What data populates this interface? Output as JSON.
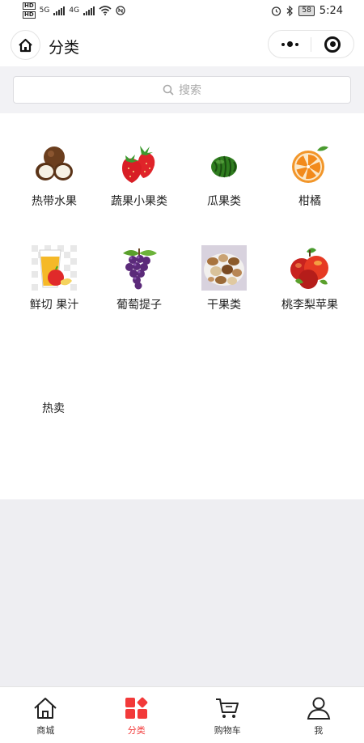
{
  "status_bar": {
    "network_labels": [
      "HD",
      "HD"
    ],
    "net1": "5G",
    "net2": "4G",
    "battery": "58",
    "time": "5:24"
  },
  "nav": {
    "title": "分类"
  },
  "search": {
    "placeholder": "搜索"
  },
  "categories": [
    {
      "label": "热带水果",
      "icon": "coconut-icon"
    },
    {
      "label": "蔬果小果类",
      "icon": "strawberry-icon"
    },
    {
      "label": "瓜果类",
      "icon": "watermelon-icon"
    },
    {
      "label": "柑橘",
      "icon": "orange-icon"
    },
    {
      "label": "鲜切 果汁",
      "icon": "juice-icon"
    },
    {
      "label": "葡萄提子",
      "icon": "grape-icon"
    },
    {
      "label": "干果类",
      "icon": "nuts-icon"
    },
    {
      "label": "桃李梨苹果",
      "icon": "apple-icon"
    }
  ],
  "section": {
    "hot": "热卖"
  },
  "tabs": [
    {
      "label": "商城",
      "icon": "home-icon"
    },
    {
      "label": "分类",
      "icon": "category-icon",
      "active": true
    },
    {
      "label": "购物车",
      "icon": "cart-icon"
    },
    {
      "label": "我",
      "icon": "user-icon"
    }
  ],
  "colors": {
    "accent": "#f23a3a",
    "background": "#eeeef2"
  }
}
